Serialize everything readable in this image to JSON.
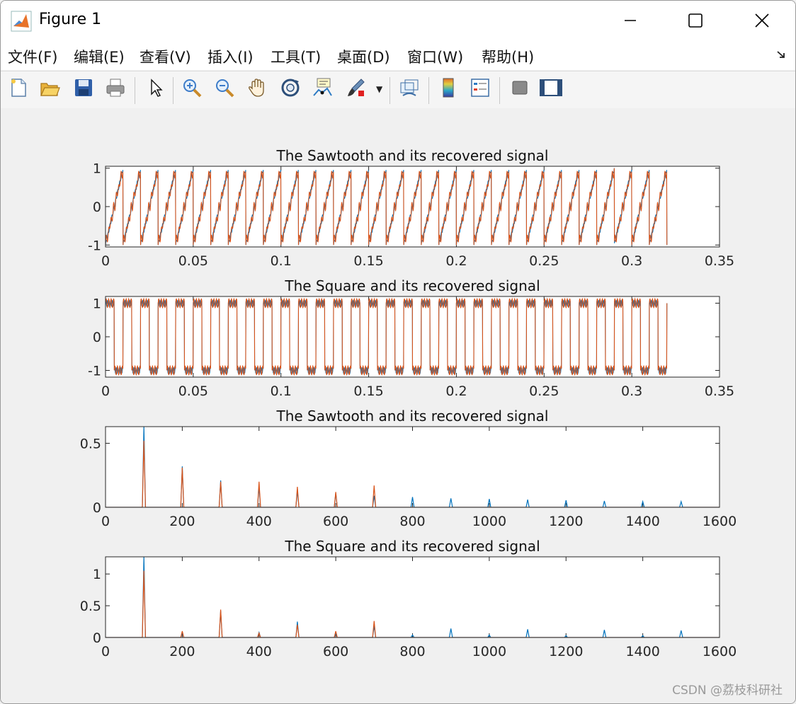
{
  "window": {
    "title": "Figure 1",
    "controls": [
      "minimize-icon",
      "maximize-icon",
      "close-icon"
    ]
  },
  "menu": {
    "items": [
      {
        "label": "文件(F)",
        "mnemonic": "F"
      },
      {
        "label": "编辑(E)",
        "mnemonic": "E"
      },
      {
        "label": "查看(V)",
        "mnemonic": "V"
      },
      {
        "label": "插入(I)",
        "mnemonic": "I"
      },
      {
        "label": "工具(T)",
        "mnemonic": "T"
      },
      {
        "label": "桌面(D)",
        "mnemonic": "D"
      },
      {
        "label": "窗口(W)",
        "mnemonic": "W"
      },
      {
        "label": "帮助(H)",
        "mnemonic": "H"
      }
    ],
    "more_icon": "dock-arrow-icon"
  },
  "toolbar": {
    "buttons": [
      "new-figure-icon",
      "open-file-icon",
      "save-icon",
      "print-icon",
      "edit-plot-icon",
      "zoom-in-icon",
      "zoom-out-icon",
      "pan-icon",
      "rotate-3d-icon",
      "data-cursor-icon",
      "brush-icon",
      "link-plot-icon",
      "colorbar-icon",
      "legend-icon",
      "hide-plot-tools-icon",
      "show-plot-tools-icon"
    ]
  },
  "colors": {
    "series1": "#0072BD",
    "series2": "#D95319",
    "axes_bg": "#ffffff",
    "figure_bg": "#f0f0f0"
  },
  "chart_data": [
    {
      "type": "line",
      "title": "The Sawtooth and its recovered signal",
      "xlim": [
        0,
        0.35
      ],
      "ylim": [
        -1.05,
        1.05
      ],
      "xticks": [
        "0",
        "0.05",
        "0.1",
        "0.15",
        "0.2",
        "0.25",
        "0.3",
        "0.35"
      ],
      "yticks": [
        "-1",
        "0",
        "1"
      ],
      "signal": {
        "shape": "sawtooth",
        "frequency_hz": 100,
        "duration_s": 0.32,
        "amplitude": 1
      },
      "series": [
        {
          "name": "",
          "color": "#0072BD",
          "description_key": "original"
        },
        {
          "name": "",
          "color": "#D95319",
          "description_key": "recovered"
        }
      ]
    },
    {
      "type": "line",
      "title": "The Square and its recovered signal",
      "xlim": [
        0,
        0.35
      ],
      "ylim": [
        -1.2,
        1.2
      ],
      "xticks": [
        "0",
        "0.05",
        "0.1",
        "0.15",
        "0.2",
        "0.25",
        "0.3",
        "0.35"
      ],
      "yticks": [
        "-1",
        "0",
        "1"
      ],
      "signal": {
        "shape": "square",
        "frequency_hz": 100,
        "duration_s": 0.32,
        "amplitude": 1
      },
      "series": [
        {
          "name": "",
          "color": "#0072BD",
          "description_key": "original"
        },
        {
          "name": "",
          "color": "#D95319",
          "description_key": "recovered"
        }
      ]
    },
    {
      "type": "line",
      "title": "The Sawtooth and its recovered signal",
      "xlim": [
        0,
        1600
      ],
      "ylim": [
        0,
        0.63
      ],
      "xticks": [
        "0",
        "200",
        "400",
        "600",
        "800",
        "1000",
        "1200",
        "1400",
        "1600"
      ],
      "yticks": [
        "0",
        "0.5"
      ],
      "series": [
        {
          "name": "",
          "color": "#0072BD",
          "peaks_x": [
            100,
            200,
            300,
            400,
            500,
            600,
            700,
            800,
            900,
            1000,
            1100,
            1200,
            1300,
            1400,
            1500
          ],
          "peaks_y": [
            0.63,
            0.32,
            0.21,
            0.16,
            0.13,
            0.11,
            0.09,
            0.08,
            0.07,
            0.065,
            0.06,
            0.055,
            0.05,
            0.045,
            0.045
          ]
        },
        {
          "name": "",
          "color": "#D95319",
          "peaks_x": [
            100,
            200,
            300,
            400,
            500,
            600,
            700
          ],
          "peaks_y": [
            0.52,
            0.31,
            0.2,
            0.2,
            0.16,
            0.12,
            0.17
          ]
        }
      ]
    },
    {
      "type": "line",
      "title": "The Square and its recovered signal",
      "xlim": [
        0,
        1600
      ],
      "ylim": [
        0,
        1.27
      ],
      "xticks": [
        "0",
        "200",
        "400",
        "600",
        "800",
        "1000",
        "1200",
        "1400",
        "1600"
      ],
      "yticks": [
        "0",
        "0.5",
        "1"
      ],
      "series": [
        {
          "name": "",
          "color": "#0072BD",
          "peaks_x": [
            100,
            200,
            300,
            400,
            500,
            600,
            700,
            800,
            900,
            1000,
            1100,
            1200,
            1300,
            1400,
            1500
          ],
          "peaks_y": [
            1.27,
            0.08,
            0.42,
            0.08,
            0.25,
            0.07,
            0.18,
            0.04,
            0.14,
            0.04,
            0.13,
            0.03,
            0.12,
            0.03,
            0.11
          ]
        },
        {
          "name": "",
          "color": "#D95319",
          "peaks_x": [
            100,
            200,
            300,
            400,
            500,
            600,
            700
          ],
          "peaks_y": [
            1.05,
            0.1,
            0.44,
            0.07,
            0.2,
            0.1,
            0.26
          ]
        }
      ]
    }
  ],
  "watermark": "CSDN @荔枝科研社"
}
